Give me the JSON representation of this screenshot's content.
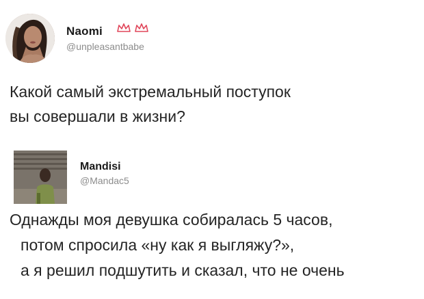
{
  "tweet1": {
    "display_name": "Naomi",
    "badge_icon": "crown-icon",
    "handle": "@unpleasantbabe",
    "text_lines": [
      "Какой самый экстремальный поступок",
      "вы совершали в жизни?"
    ]
  },
  "tweet2": {
    "display_name": "Mandisi",
    "handle": "@Mandac5",
    "text_lines": [
      "Однажды моя девушка собиралась 5 часов,",
      "потом  спросила «ну как я выгляжу?»,",
      "а я решил подшутить и сказал, что не очень"
    ]
  },
  "colors": {
    "text": "#242424",
    "handle": "#8c8c8c",
    "crown": "#e0465a",
    "background": "#ffffff"
  }
}
